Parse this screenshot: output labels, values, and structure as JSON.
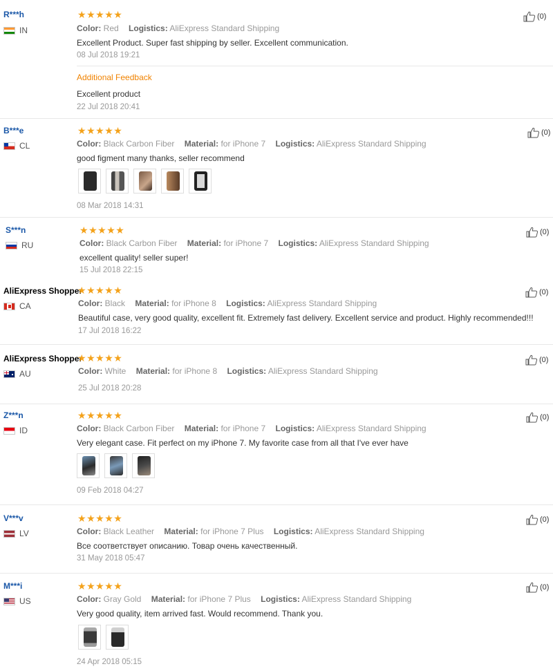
{
  "labels": {
    "color": "Color:",
    "material": "Material:",
    "logistics": "Logistics:",
    "additional_feedback": "Additional Feedback"
  },
  "star_color": "#f4a21b",
  "reviews": [
    {
      "user": "R***h",
      "country": "IN",
      "rating": 5,
      "color": "Red",
      "material": null,
      "logistics": "AliExpress Standard Shipping",
      "text": "Excellent Product. Super fast shipping by seller. Excellent communication.",
      "date": "08 Jul 2018 19:21",
      "additional": {
        "text": "Excellent product",
        "date": "22 Jul 2018 20:41"
      },
      "likes": "(0)",
      "photos": 0
    },
    {
      "user": "B***e",
      "country": "CL",
      "rating": 5,
      "color": "Black Carbon Fiber",
      "material": "for iPhone 7",
      "logistics": "AliExpress Standard Shipping",
      "text": "good figment many thanks, seller recommend",
      "date": "08 Mar 2018 14:31",
      "likes": "(0)",
      "photos": 5
    },
    {
      "user": "S***n",
      "country": "RU",
      "rating": 5,
      "color": "Black Carbon Fiber",
      "material": "for iPhone 7",
      "logistics": "AliExpress Standard Shipping",
      "text": "excellent quality! seller super!",
      "date": "15 Jul 2018 22:15",
      "likes": "(0)",
      "photos": 0
    },
    {
      "user": "AliExpress Shopper",
      "country": "CA",
      "rating": 5,
      "color": "Black",
      "material": "for iPhone 8",
      "logistics": "AliExpress Standard Shipping",
      "text": "Beautiful case, very good quality, excellent fit. Extremely fast delivery. Excellent service and product. Highly recommended!!!",
      "date": "17 Jul 2018 16:22",
      "likes": "(0)",
      "photos": 0
    },
    {
      "user": "AliExpress Shopper",
      "country": "AU",
      "rating": 5,
      "color": "White",
      "material": "for iPhone 8",
      "logistics": "AliExpress Standard Shipping",
      "text": "",
      "date": "25 Jul 2018 20:28",
      "likes": "(0)",
      "photos": 0
    },
    {
      "user": "Z***n",
      "country": "ID",
      "rating": 5,
      "color": "Black Carbon Fiber",
      "material": "for iPhone 7",
      "logistics": "AliExpress Standard Shipping",
      "text": "Very elegant case. Fit perfect on my iPhone 7. My favorite case from all that I've ever have",
      "date": "09 Feb 2018 04:27",
      "likes": "(0)",
      "photos": 3
    },
    {
      "user": "V***v",
      "country": "LV",
      "rating": 5,
      "color": "Black Leather",
      "material": "for iPhone 7 Plus",
      "logistics": "AliExpress Standard Shipping",
      "text": "Все соответствует описанию. Товар очень качественный.",
      "date": "31 May 2018 05:47",
      "likes": "(0)",
      "photos": 0
    },
    {
      "user": "M***i",
      "country": "US",
      "rating": 5,
      "color": "Gray Gold",
      "material": "for iPhone 7 Plus",
      "logistics": "AliExpress Standard Shipping",
      "text": "Very good quality, item arrived fast. Would recommend. Thank you.",
      "date": "24 Apr 2018 05:15",
      "likes": "(0)",
      "photos": 2
    }
  ]
}
